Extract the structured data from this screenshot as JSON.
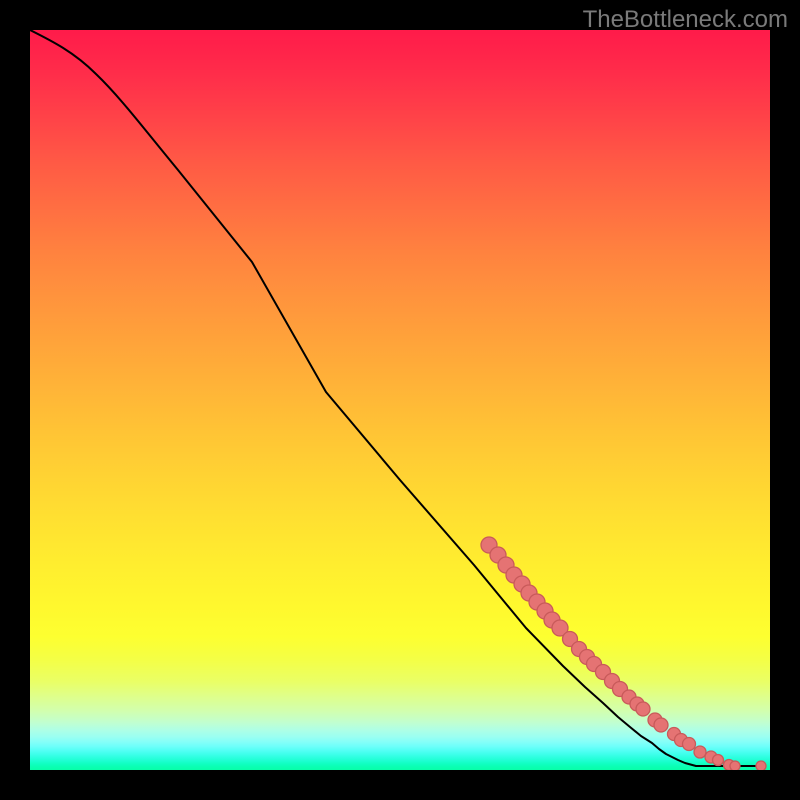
{
  "watermark": "TheBottleneck.com",
  "chart_data": {
    "type": "line",
    "title": "",
    "xlabel": "",
    "ylabel": "",
    "xlim": [
      0,
      100
    ],
    "ylim": [
      0,
      100
    ],
    "grid": false,
    "legend": false,
    "series": [
      {
        "name": "curve",
        "type": "line",
        "x": [
          0,
          3,
          6,
          9,
          12,
          15,
          18,
          25,
          35,
          45,
          55,
          65,
          72,
          77,
          80,
          82.5,
          84.5,
          86,
          87.5,
          89,
          90,
          91,
          92.5,
          93.5,
          94.5,
          95.3,
          98.8
        ],
        "y": [
          100,
          98.5,
          96.5,
          94,
          91,
          87.5,
          83.8,
          75,
          62.5,
          50.5,
          38.5,
          27,
          19,
          13.5,
          10.5,
          8.2,
          6.5,
          5.2,
          4.1,
          3.1,
          2.5,
          1.9,
          1.2,
          0.8,
          0.55,
          0.48,
          0.48
        ]
      },
      {
        "name": "points",
        "type": "scatter",
        "x": [
          62,
          63.2,
          64.3,
          65.4,
          66.5,
          67.5,
          68.5,
          69.6,
          70.6,
          71.6,
          73.0,
          74.2,
          75.3,
          76.2,
          77.4,
          78.6,
          79.7,
          81.0,
          82.0,
          82.8,
          84.5,
          85.3,
          87.0,
          88.0,
          89.0,
          90.6,
          92.0,
          93.0,
          94.5,
          95.3,
          98.8
        ],
        "y": [
          30.4,
          29.0,
          27.7,
          26.4,
          25.1,
          23.9,
          22.7,
          21.5,
          20.3,
          19.2,
          17.7,
          16.4,
          15.3,
          14.3,
          13.2,
          12.0,
          11.0,
          9.8,
          8.9,
          8.2,
          6.8,
          6.1,
          4.9,
          4.1,
          3.5,
          2.5,
          1.8,
          1.3,
          0.7,
          0.5,
          0.5
        ]
      }
    ],
    "colors": {
      "line": "#000000",
      "point_fill": "#e57373",
      "point_stroke": "#c85a5a",
      "gradient_top": "#ff1b4a",
      "gradient_mid": "#ffe030",
      "gradient_bottom": "#08ffa8"
    }
  }
}
